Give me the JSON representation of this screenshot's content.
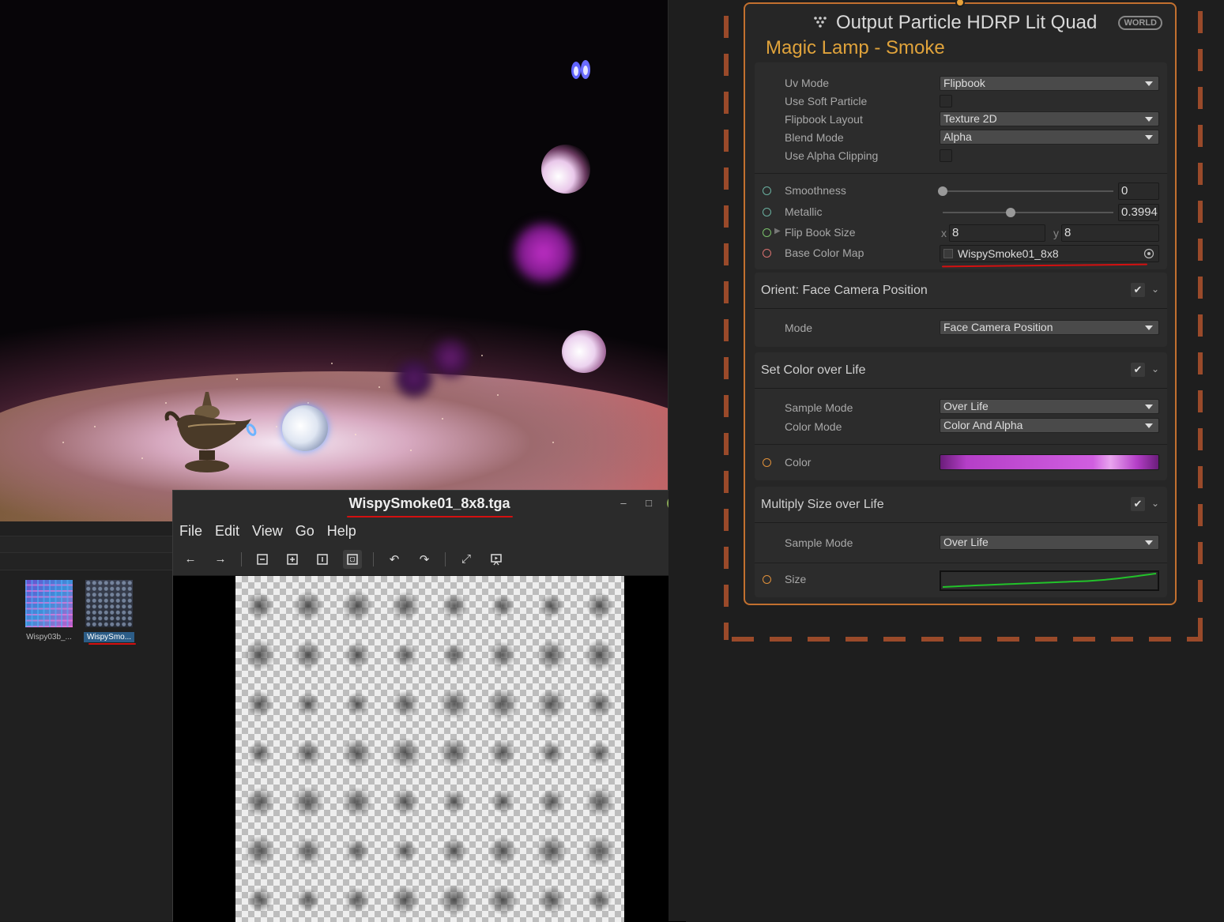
{
  "viewer": {
    "title": "WispySmoke01_8x8.tga",
    "menu": [
      "File",
      "Edit",
      "View",
      "Go",
      "Help"
    ],
    "win_minimize": "–",
    "win_maximize": "□",
    "win_close": "✕"
  },
  "project": {
    "assets": [
      {
        "name": "Wispy03b_...",
        "selected": false
      },
      {
        "name": "WispySmo...",
        "selected": true
      }
    ]
  },
  "node": {
    "title": "Output Particle HDRP Lit Quad",
    "space_badge": "WORLD",
    "subtitle": "Magic Lamp - Smoke",
    "settings": {
      "uv_mode_label": "Uv Mode",
      "uv_mode_value": "Flipbook",
      "soft_particle_label": "Use Soft Particle",
      "flipbook_layout_label": "Flipbook Layout",
      "flipbook_layout_value": "Texture 2D",
      "blend_mode_label": "Blend Mode",
      "blend_mode_value": "Alpha",
      "alpha_clip_label": "Use Alpha Clipping"
    },
    "inputs": {
      "smoothness_label": "Smoothness",
      "smoothness_value": "0",
      "smoothness_level": 0.0,
      "metallic_label": "Metallic",
      "metallic_value": "0.3994",
      "metallic_level": 0.3994,
      "flipbook_size_label": "Flip Book Size",
      "flipbook_x_label": "x",
      "flipbook_x": "8",
      "flipbook_y_label": "y",
      "flipbook_y": "8",
      "base_color_map_label": "Base Color Map",
      "base_color_map_value": "WispySmoke01_8x8"
    },
    "blocks": [
      {
        "title": "Orient: Face Camera Position",
        "rows": [
          {
            "label": "Mode",
            "value": "Face Camera Position"
          }
        ]
      },
      {
        "title": "Set Color over Life",
        "rows": [
          {
            "label": "Sample Mode",
            "value": "Over Life"
          },
          {
            "label": "Color Mode",
            "value": "Color And Alpha"
          }
        ],
        "port_label": "Color"
      },
      {
        "title": "Multiply Size over Life",
        "rows": [
          {
            "label": "Sample Mode",
            "value": "Over Life"
          }
        ],
        "port_label": "Size"
      }
    ]
  },
  "colors": {
    "node_border": "#c2702f",
    "subtitle": "#e0a33b",
    "gradient_start": "#b53fc8",
    "gradient_end": "#d05ee0",
    "curve": "#22c22a",
    "annotation": "#d41010"
  },
  "icons": {
    "nav": [
      "arrow-left-icon",
      "arrow-right-icon"
    ],
    "zoom": [
      "zoom-out-icon",
      "zoom-in-icon",
      "zoom-normal-icon",
      "zoom-fit-icon"
    ],
    "rotate": [
      "rotate-left-icon",
      "rotate-right-icon"
    ],
    "view": [
      "fullscreen-icon",
      "slideshow-icon"
    ]
  }
}
